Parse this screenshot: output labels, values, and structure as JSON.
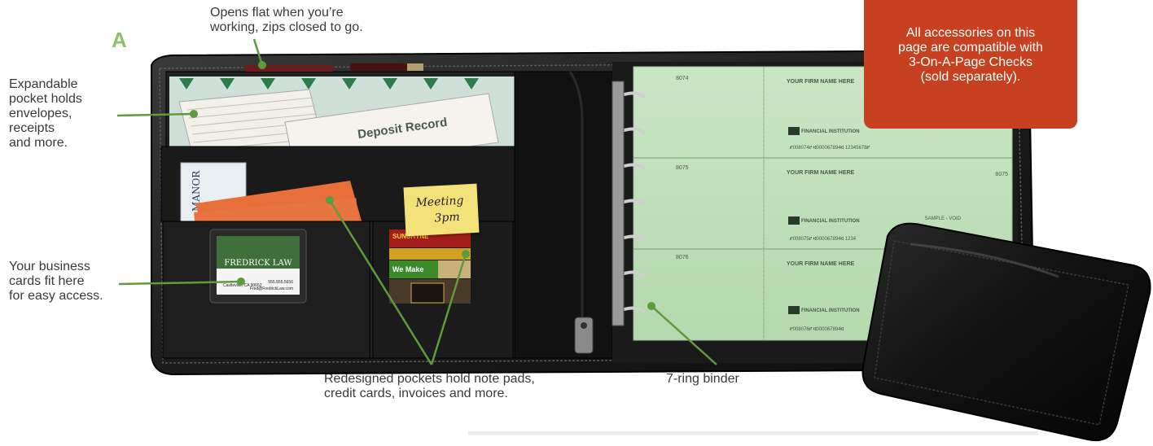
{
  "section": {
    "letter": "A"
  },
  "callout": {
    "lines": [
      "All accessories on this",
      "page are compatible with",
      "3-On-A-Page Checks",
      "(sold separately)."
    ],
    "color": "#c7401f"
  },
  "annotations": {
    "zip": {
      "lines": [
        "Opens flat when you’re",
        "working, zips closed to go."
      ]
    },
    "expandable": {
      "lines": [
        "Expandable",
        "pocket holds",
        "envelopes,",
        "receipts",
        "and more."
      ]
    },
    "business_cards": {
      "lines": [
        "Your business",
        "cards fit here",
        "for easy access."
      ]
    },
    "pockets": {
      "lines": [
        "Redesigned pockets hold note pads,",
        "credit cards, invoices and more."
      ]
    },
    "binder": {
      "lines": [
        "7-ring binder"
      ]
    }
  },
  "leader_color": "#5d9b3d",
  "product_text": {
    "deposit_record": "Deposit Record",
    "law_firm": "FREDRICK LAW",
    "card_phone": "555.555.5656",
    "card_email": "Fred@FredrickLaw.com",
    "card_city": "Castleville, CA 90652",
    "sticky_line1": "Meeting",
    "sticky_line2": "3pm",
    "card_sunshyne": "SUNSHYNE",
    "card_we_make": "We Make",
    "manor": "MANOR"
  },
  "checks": [
    {
      "number": "8074",
      "firm": "YOUR FIRM NAME HERE",
      "bank": "FINANCIAL INSTITUTION",
      "micr": "⑈008074⑈ ⑆000067894⑆ 12345678⑈"
    },
    {
      "number": "8075",
      "firm": "YOUR FIRM NAME HERE",
      "bank": "FINANCIAL INSTITUTION",
      "micr": "⑈008075⑈ ⑆000067894⑆ 1234",
      "sample": "SAMPLE - VOID"
    },
    {
      "number": "8076",
      "firm": "YOUR FIRM NAME HERE",
      "bank": "FINANCIAL INSTITUTION",
      "micr": "⑈008076⑈ ⑆000067894⑆"
    }
  ]
}
